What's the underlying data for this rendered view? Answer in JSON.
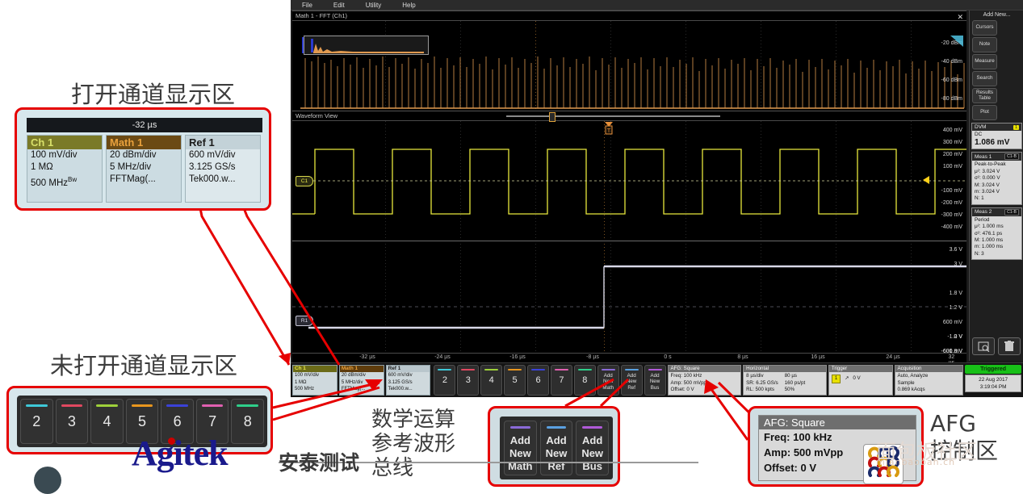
{
  "scope": {
    "menubar": [
      "File",
      "Edit",
      "Utility",
      "Help"
    ],
    "math_pane_title": "Math 1 - FFT (Ch1)",
    "waveform_pane_title": "Waveform View",
    "fft_axis_labels": [
      "-20 dBm",
      "-40 dBm",
      "-60 dBm",
      "-80 dBm"
    ],
    "ch1_axis_labels": [
      "400 mV",
      "300 mV",
      "200 mV",
      "100 mV",
      "-100 mV",
      "-200 mV",
      "-300 mV",
      "-400 mV"
    ],
    "ref1_axis_labels": [
      "3.6 V",
      "3 V",
      "1.8 V",
      "1.2 V",
      "600 mV",
      "0 V",
      "-600 mV",
      "-1.2 V",
      "-1.8 V"
    ],
    "time_axis_labels": [
      "-32 µs",
      "-24 µs",
      "-16 µs",
      "-8 µs",
      "0 s",
      "8 µs",
      "16 µs",
      "24 µs",
      "32 µs"
    ],
    "ch1_tag": "C1",
    "ref1_tag": "R1",
    "right_panel": {
      "add_new_label": "Add New...",
      "buttons": [
        "Cursors",
        "Note",
        "Measure",
        "Search",
        "Results Table",
        "Plot"
      ],
      "dvm": {
        "title": "DVM",
        "badge": "1",
        "mode": "DC",
        "value": "1.086 mV"
      },
      "meas1": {
        "title": "Meas 1",
        "badge": "C1-B",
        "name": "Peak-to-Peak",
        "rows": [
          "μ²: 3.024 V",
          "σ²: 0.000 V",
          "M: 3.024 V",
          "m: 3.024 V",
          "N: 1"
        ]
      },
      "meas2": {
        "title": "Meas 2",
        "badge": "C1-B",
        "name": "Period",
        "rows": [
          "μ²: 1.000 ms",
          "σ²: 476.1 ps",
          "M: 1.000 ms",
          "m: 1.000 ms",
          "N: 3"
        ]
      }
    },
    "waveform_badges": [
      {
        "title": "Ch 1",
        "lines": [
          "100 mV/div",
          "1 MΩ",
          "500 MHz"
        ],
        "color": "#c8c83c"
      },
      {
        "title": "Math 1",
        "lines": [
          "20 dBm/div",
          "5 MHz/div",
          "FFTMag(..."
        ],
        "color": "#e0963c"
      },
      {
        "title": "Ref 1",
        "lines": [
          "600 mV/div",
          "3.125 GS/s",
          "Tek000.w..."
        ],
        "color": "#dcdce8"
      }
    ],
    "channel_buttons": [
      {
        "label": "2",
        "color": "#3ec8d8"
      },
      {
        "label": "3",
        "color": "#e04860"
      },
      {
        "label": "4",
        "color": "#9ed03a"
      },
      {
        "label": "5",
        "color": "#e8961e"
      },
      {
        "label": "6",
        "color": "#3a42d8"
      },
      {
        "label": "7",
        "color": "#e060b0"
      },
      {
        "label": "8",
        "color": "#2ecf8a"
      }
    ],
    "add_new_buttons": [
      {
        "label": "Add New Math",
        "line1": "Add",
        "line2": "New",
        "line3": "Math",
        "color": "#8a6ad8"
      },
      {
        "label": "Add New Ref",
        "line1": "Add",
        "line2": "New",
        "line3": "Ref",
        "color": "#5aa0e0"
      },
      {
        "label": "Add New Bus",
        "line1": "Add",
        "line2": "New",
        "line3": "Bus",
        "color": "#b05ad8"
      }
    ],
    "afg": {
      "title": "AFG: Square",
      "freq": "Freq: 100 kHz",
      "amp": "Amp: 500 mVpp",
      "offset": "Offset: 0 V"
    },
    "horizontal": {
      "title": "Horizontal",
      "col1": [
        "8 µs/div",
        "SR: 6.25 GS/s",
        "RL: 500 kpts"
      ],
      "col2": [
        "80 µs",
        "160 ps/pt",
        "50%"
      ]
    },
    "trigger": {
      "title": "Trigger",
      "source": "1",
      "level": "0 V"
    },
    "acquisition": {
      "title": "Acquisition",
      "rows": [
        "Auto,    Analyze",
        "Sample",
        "0.869 kAcqs"
      ]
    },
    "status": {
      "state": "Triggered",
      "date": "22 Aug 2017",
      "time": "3:19:04 PM"
    }
  },
  "callouts": {
    "open_channels_title": "打开通道显示区",
    "closed_channels_title": "未打开通道显示区",
    "math_ref_bus_lines": [
      "数学运算",
      "参考波形",
      "总线"
    ],
    "afg_lines": [
      "AFG",
      "控制区"
    ],
    "channel_card_header": "-32 µs",
    "channel_cards": [
      {
        "title": "Ch 1",
        "l1": "100 mV/div",
        "l2": "1 MΩ",
        "l3": "500 MHz",
        "sup": "Bw",
        "color": "#7a7a28",
        "titlecolor": "#d8e06a"
      },
      {
        "title": "Math 1",
        "l1": "20 dBm/div",
        "l2": "5 MHz/div",
        "l3": "FFTMag(...",
        "sup": "",
        "color": "#6b4a14",
        "titlecolor": "#e8a03c"
      },
      {
        "title": "Ref 1",
        "l1": "600 mV/div",
        "l2": "3.125 GS/s",
        "l3": "Tek000.w...",
        "sup": "",
        "color": "#c3d2d8",
        "titlecolor": "#1b1b1b"
      }
    ],
    "big_channel_buttons": [
      {
        "label": "2",
        "color": "#3ec8d8"
      },
      {
        "label": "3",
        "color": "#e04860"
      },
      {
        "label": "4",
        "color": "#9ed03a"
      },
      {
        "label": "5",
        "color": "#e8961e"
      },
      {
        "label": "6",
        "color": "#3a42d8"
      },
      {
        "label": "7",
        "color": "#e060b0"
      },
      {
        "label": "8",
        "color": "#2ecf8a"
      }
    ],
    "big_add_buttons": [
      {
        "line1": "Add",
        "line2": "New",
        "line3": "Math",
        "color": "#8a6ad8"
      },
      {
        "line1": "Add",
        "line2": "New",
        "line3": "Ref",
        "color": "#5aa0e0"
      },
      {
        "line1": "Add",
        "line2": "New",
        "line3": "Bus",
        "color": "#b05ad8"
      }
    ],
    "afg_card": {
      "title": "AFG: Square",
      "freq": "Freq: 100 kHz",
      "amp": "Amp: 500 mVpp",
      "offset": "Offset: 0 V"
    }
  },
  "watermarks": {
    "brand": "Agitek",
    "brand_cn": "安泰测试",
    "site": "面包板社区",
    "site_url": "mianbaoban.cn"
  }
}
